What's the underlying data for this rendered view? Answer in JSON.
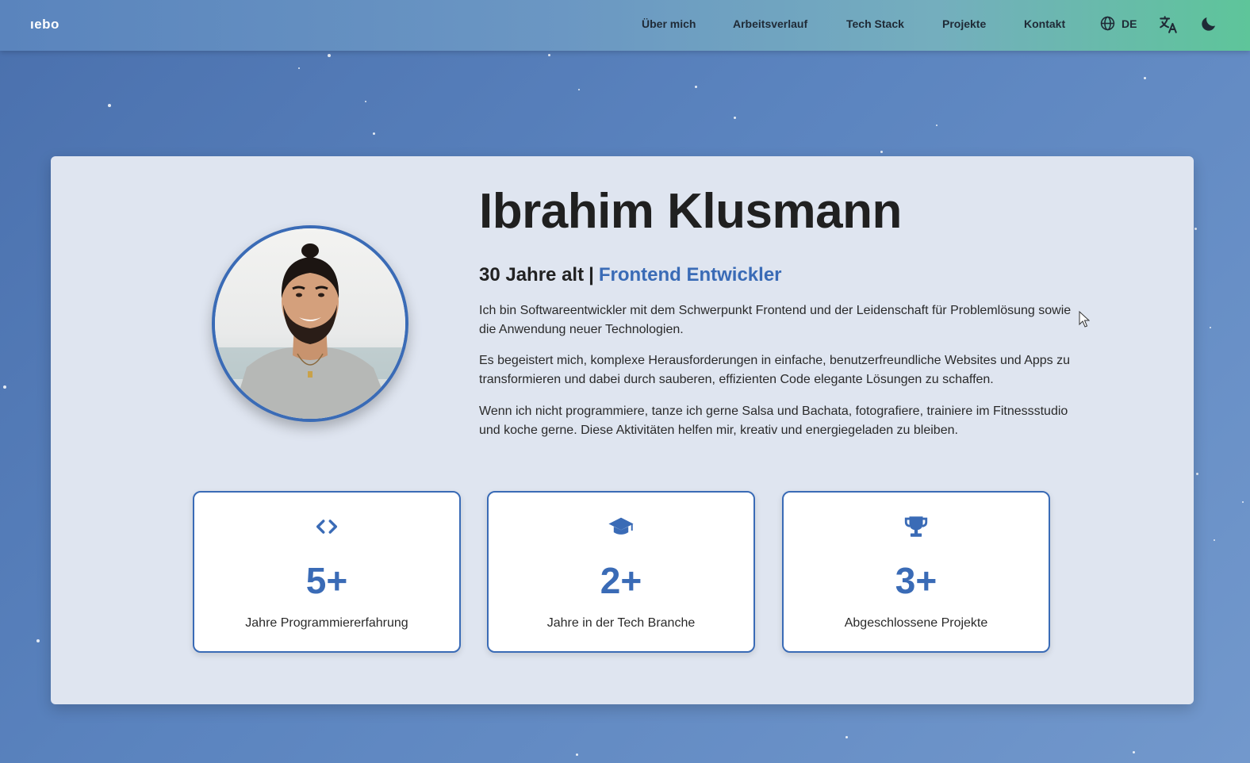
{
  "header": {
    "logo": "ıebo",
    "nav": [
      "Über mich",
      "Arbeitsverlauf",
      "Tech Stack",
      "Projekte",
      "Kontakt"
    ],
    "language": "DE",
    "icons": [
      "globe-icon",
      "translate-icon",
      "moon-icon"
    ]
  },
  "profile": {
    "name": "Ibrahim Klusmann",
    "age": "30 Jahre alt",
    "separator": "|",
    "role": "Frontend Entwickler",
    "paragraphs": [
      "Ich bin Softwareentwickler mit dem Schwerpunkt Frontend und der Leidenschaft für Problemlösung sowie die Anwendung neuer Technologien.",
      "Es begeistert mich, komplexe Herausforderungen in einfache, benutzerfreundliche Websites und Apps zu transformieren und dabei durch sauberen, effizienten Code elegante Lösungen zu schaffen.",
      "Wenn ich nicht programmiere, tanze ich gerne Salsa und Bachata, fotografiere, trainiere im Fitnessstudio und koche gerne. Diese Aktivitäten helfen mir, kreativ und energiegeladen zu bleiben."
    ]
  },
  "stats": [
    {
      "icon": "code-icon",
      "value": "5+",
      "label": "Jahre Programmiererfahrung"
    },
    {
      "icon": "graduation-cap-icon",
      "value": "2+",
      "label": "Jahre in der Tech Branche"
    },
    {
      "icon": "trophy-icon",
      "value": "3+",
      "label": "Abgeschlossene Projekte"
    }
  ],
  "colors": {
    "accent": "#3a6bb6",
    "card_background": "#dfe5f0",
    "header_gradient_start": "#5a84bd",
    "header_gradient_end": "#5ec59a"
  }
}
